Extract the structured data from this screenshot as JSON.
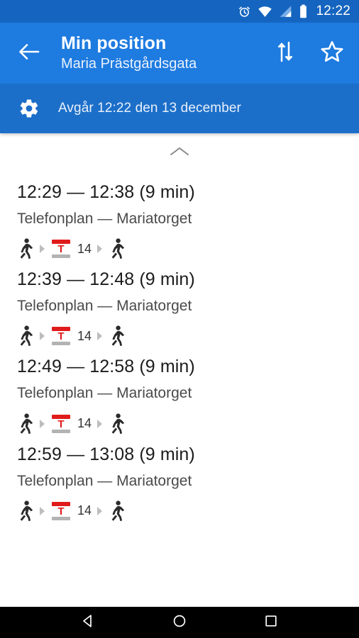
{
  "status_bar": {
    "time": "12:22",
    "icons": [
      "alarm-icon",
      "wifi-icon",
      "signal-icon",
      "battery-icon"
    ],
    "background": "#1565c0"
  },
  "toolbar": {
    "back_icon": "back-arrow-icon",
    "title": "Min position",
    "subtitle": "Maria Prästgårdsgata",
    "swap_icon": "swap-vertical-icon",
    "favorite_icon": "star-outline-icon",
    "background": "#1e7be0"
  },
  "departure_bar": {
    "gear_icon": "gear-icon",
    "text": "Avgår 12:22 den 13 december",
    "background": "#1c6fc9"
  },
  "content": {
    "collapse_icon": "chevron-up-icon",
    "journeys": [
      {
        "time": "12:29 — 12:38 (9 min)",
        "route": "Telefonplan — Mariatorget",
        "legs": [
          {
            "type": "walk",
            "icon": "walking-person-icon"
          },
          {
            "type": "metro",
            "icon": "metro-t-icon",
            "letter": "T",
            "line": "14"
          },
          {
            "type": "walk",
            "icon": "walking-person-icon"
          }
        ]
      },
      {
        "time": "12:39 — 12:48 (9 min)",
        "route": "Telefonplan — Mariatorget",
        "legs": [
          {
            "type": "walk",
            "icon": "walking-person-icon"
          },
          {
            "type": "metro",
            "icon": "metro-t-icon",
            "letter": "T",
            "line": "14"
          },
          {
            "type": "walk",
            "icon": "walking-person-icon"
          }
        ]
      },
      {
        "time": "12:49 — 12:58 (9 min)",
        "route": "Telefonplan — Mariatorget",
        "legs": [
          {
            "type": "walk",
            "icon": "walking-person-icon"
          },
          {
            "type": "metro",
            "icon": "metro-t-icon",
            "letter": "T",
            "line": "14"
          },
          {
            "type": "walk",
            "icon": "walking-person-icon"
          }
        ]
      },
      {
        "time": "12:59 — 13:08 (9 min)",
        "route": "Telefonplan — Mariatorget",
        "legs": [
          {
            "type": "walk",
            "icon": "walking-person-icon"
          },
          {
            "type": "metro",
            "icon": "metro-t-icon",
            "letter": "T",
            "line": "14"
          },
          {
            "type": "walk",
            "icon": "walking-person-icon"
          }
        ]
      }
    ]
  },
  "nav_bar": {
    "back_icon": "nav-back-icon",
    "home_icon": "nav-home-icon",
    "recents_icon": "nav-recents-icon",
    "background": "#000000"
  },
  "colors": {
    "metro_red": "#e01b1b",
    "metro_gray": "#b3b3b3",
    "accent_blue": "#1e7be0"
  }
}
